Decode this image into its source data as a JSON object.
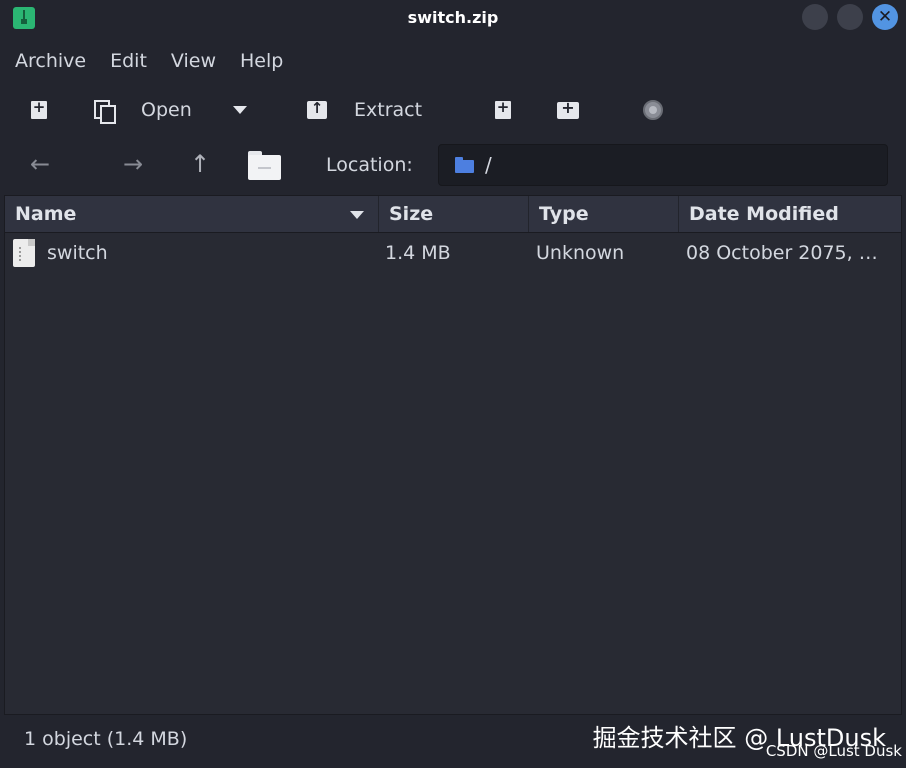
{
  "window": {
    "title": "switch.zip",
    "close_glyph": "✕"
  },
  "menubar": {
    "items": [
      "Archive",
      "Edit",
      "View",
      "Help"
    ]
  },
  "toolbar": {
    "new_icon": "new-archive-icon",
    "open_label": "Open",
    "extract_label": "Extract",
    "add_files_icon": "add-files-icon",
    "add_folder_icon": "add-folder-icon",
    "stop_icon": "stop-icon"
  },
  "location": {
    "back_glyph": "←",
    "forward_glyph": "→",
    "up_glyph": "↑",
    "label": "Location:",
    "path": "/"
  },
  "columns": [
    {
      "label": "Name",
      "sorted": "descending"
    },
    {
      "label": "Size"
    },
    {
      "label": "Type"
    },
    {
      "label": "Date Modified"
    }
  ],
  "files": [
    {
      "name": "switch",
      "size": "1.4 MB",
      "type": "Unknown",
      "date": "08 October 2075, …"
    }
  ],
  "status": {
    "text": "1 object (1.4 MB)"
  },
  "watermark": {
    "line1": "掘金技术社区 @ LustDusk",
    "line2": "CSDN @Lust Dusk"
  },
  "colors": {
    "background": "#23252e",
    "pane": "#282a33",
    "header": "#303340",
    "accent": "#5294e2",
    "app_icon": "#2bb673",
    "folder": "#4d7fe0"
  }
}
